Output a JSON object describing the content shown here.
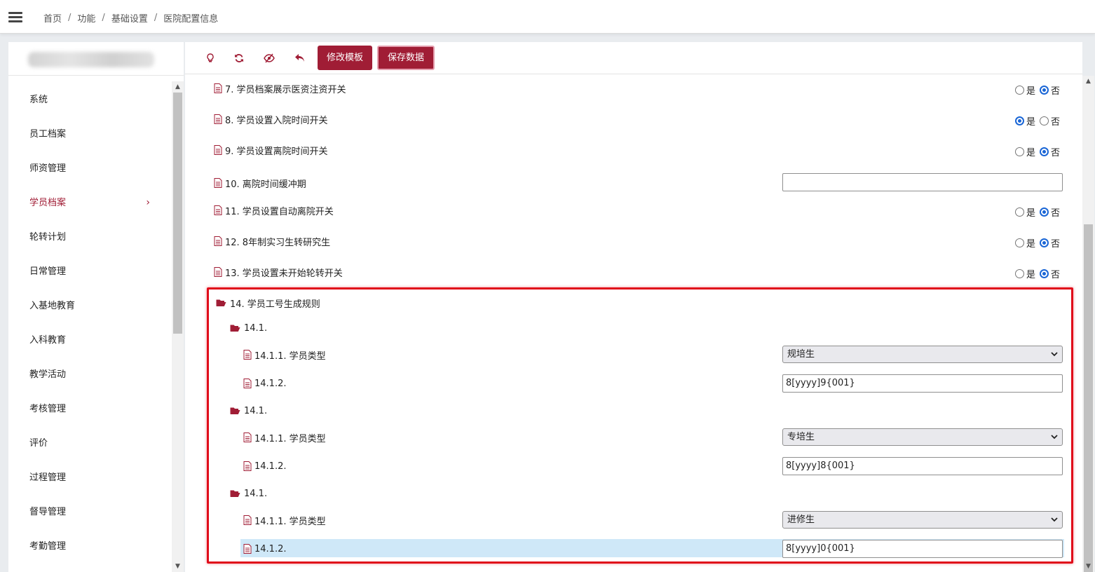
{
  "breadcrumb": {
    "items": [
      "首页",
      "功能",
      "基础设置",
      "医院配置信息"
    ],
    "separator": "/"
  },
  "sidebar": {
    "items": [
      {
        "label": "系统"
      },
      {
        "label": "员工档案"
      },
      {
        "label": "师资管理"
      },
      {
        "label": "学员档案",
        "active": true,
        "chevron": "›"
      },
      {
        "label": "轮转计划"
      },
      {
        "label": "日常管理"
      },
      {
        "label": "入基地教育"
      },
      {
        "label": "入科教育"
      },
      {
        "label": "教学活动"
      },
      {
        "label": "考核管理"
      },
      {
        "label": "评价"
      },
      {
        "label": "过程管理"
      },
      {
        "label": "督导管理"
      },
      {
        "label": "考勤管理"
      }
    ]
  },
  "toolbar": {
    "icons": [
      "lightbulb-icon",
      "refresh-icon",
      "hide-icon",
      "undo-icon"
    ],
    "edit_template_label": "修改模板",
    "save_data_label": "保存数据"
  },
  "radio_labels": {
    "yes": "是",
    "no": "否"
  },
  "settings": [
    {
      "label": "7. 学员档案展示医资注资开关",
      "value": "否"
    },
    {
      "label": "8. 学员设置入院时间开关",
      "value": "是"
    },
    {
      "label": "9. 学员设置离院时间开关",
      "value": "否"
    },
    {
      "label": "10. 离院时间缓冲期",
      "value": ""
    },
    {
      "label": "11. 学员设置自动离院开关",
      "value": "否"
    },
    {
      "label": "12. 8年制实习生转研究生",
      "value": "否"
    },
    {
      "label": "13. 学员设置未开始轮转开关",
      "value": "否"
    }
  ],
  "rule_group": {
    "label": "14. 学员工号生成规则",
    "entries": [
      {
        "label": "14.1.",
        "type_label": "14.1.1. 学员类型",
        "type_value": "规培生",
        "pattern_label": "14.1.2.",
        "pattern_value": "8[yyyy]9{001}"
      },
      {
        "label": "14.1.",
        "type_label": "14.1.1. 学员类型",
        "type_value": "专培生",
        "pattern_label": "14.1.2.",
        "pattern_value": "8[yyyy]8{001}"
      },
      {
        "label": "14.1.",
        "type_label": "14.1.1. 学员类型",
        "type_value": "进修生",
        "pattern_label": "14.1.2.",
        "pattern_value": "8[yyyy]0{001}"
      }
    ]
  },
  "colors": {
    "brand": "#a01d35",
    "radio_checked": "#1a66d6",
    "highlight": "#cfe8f8",
    "annotation_frame": "#e00c1a"
  }
}
